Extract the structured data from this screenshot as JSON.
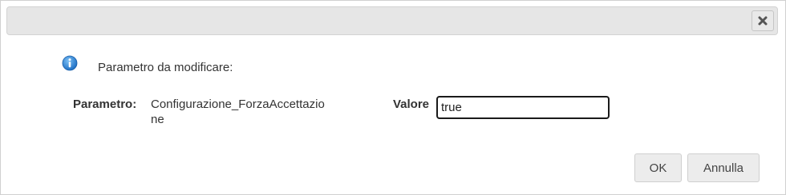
{
  "dialog": {
    "close_icon": "close-icon",
    "info_icon": "info-icon",
    "intro_text": "Parametro da modificare:",
    "parameter_label": "Parametro:",
    "parameter_value": "Configurazione_ForzaAccettazione",
    "value_label": "Valore",
    "value_input": "true",
    "ok_label": "OK",
    "cancel_label": "Annulla"
  },
  "colors": {
    "titlebar": "#e6e6e6",
    "info_blue": "#2a7fd4",
    "button_bg": "#ececec"
  }
}
